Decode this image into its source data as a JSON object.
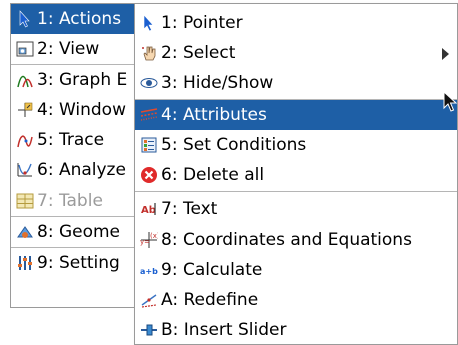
{
  "left_menu": {
    "items": [
      {
        "label": "1: Actions",
        "icon": "pointer-arrow-icon",
        "selected": true
      },
      {
        "label": "2: View",
        "icon": "view-icon"
      },
      {
        "label": "3: Graph E",
        "icon": "graph-icon"
      },
      {
        "label": "4: Window",
        "icon": "window-icon"
      },
      {
        "label": "5: Trace",
        "icon": "trace-icon"
      },
      {
        "label": "6: Analyze",
        "icon": "analyze-icon"
      },
      {
        "label": "7: Table",
        "icon": "table-icon",
        "disabled": true
      },
      {
        "label": "8: Geome",
        "icon": "geometry-icon"
      },
      {
        "label": "9: Setting",
        "icon": "settings-icon"
      }
    ]
  },
  "sub_menu": {
    "items": [
      {
        "label": "1: Pointer",
        "icon": "pointer-arrow-icon"
      },
      {
        "label": "2: Select",
        "icon": "select-hand-icon",
        "has_submenu": true
      },
      {
        "label": "3: Hide/Show",
        "icon": "eye-icon"
      },
      {
        "label": "4: Attributes",
        "icon": "attributes-icon",
        "selected": true
      },
      {
        "label": "5: Set Conditions",
        "icon": "conditions-icon"
      },
      {
        "label": "6: Delete all",
        "icon": "delete-icon"
      },
      {
        "label": "7: Text",
        "icon": "text-icon"
      },
      {
        "label": "8: Coordinates and Equations",
        "icon": "coordinates-icon"
      },
      {
        "label": "9: Calculate",
        "icon": "calculate-icon"
      },
      {
        "label": "A: Redefine",
        "icon": "redefine-icon"
      },
      {
        "label": "B: Insert Slider",
        "icon": "slider-icon"
      }
    ]
  },
  "colors": {
    "selection": "#1e5fa6",
    "disabled_text": "#9b9b9b"
  }
}
